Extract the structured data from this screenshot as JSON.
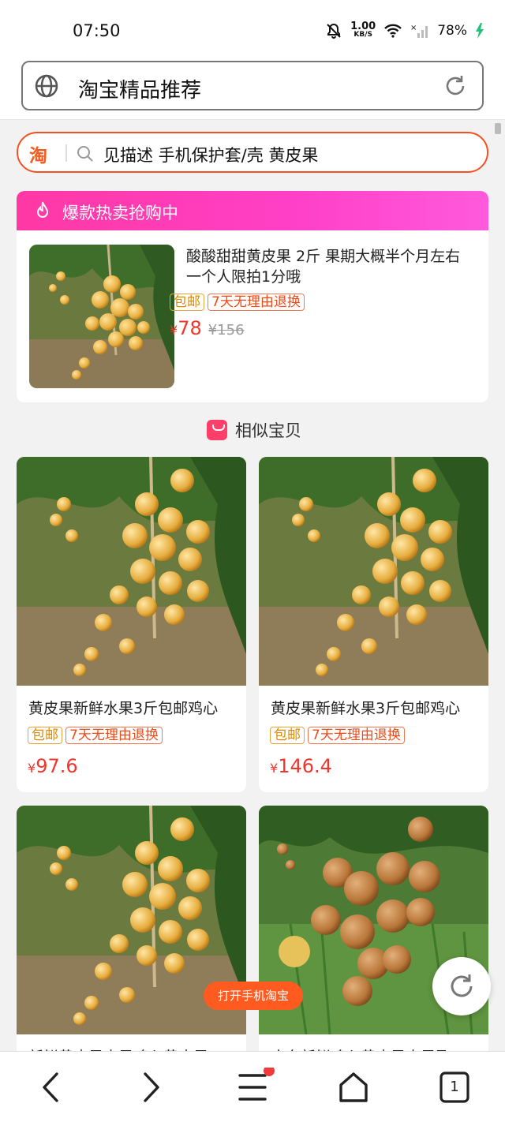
{
  "status_bar": {
    "time": "07:50",
    "net_speed": "1.00",
    "net_unit": "KB/S",
    "battery": "78%"
  },
  "address_bar": {
    "title": "淘宝精品推荐"
  },
  "search": {
    "logo": "淘",
    "query": "见描述 手机保护套/壳 黄皮果"
  },
  "hot_sale": {
    "banner": "爆款热卖抢购中",
    "product": {
      "title": "酸酸甜甜黄皮果 2斤 果期大概半个月左右 一个人限拍1分哦",
      "tags": [
        "包邮",
        "7天无理由退换"
      ],
      "currency": "¥",
      "price": "78",
      "old_price": "¥156"
    }
  },
  "similar": {
    "heading": "相似宝贝"
  },
  "products": [
    {
      "title": "黄皮果新鲜水果3斤包邮鸡心",
      "tags": [
        "包邮",
        "7天无理由退换"
      ],
      "currency": "¥",
      "price": "97.6"
    },
    {
      "title": "黄皮果新鲜水果3斤包邮鸡心",
      "tags": [
        "包邮",
        "7天无理由退换"
      ],
      "currency": "¥",
      "price": "146.4"
    },
    {
      "title": "新鲜黄皮果水果鸡心黄皮果",
      "tags": [],
      "currency": "",
      "price": ""
    },
    {
      "title": "广东新鲜鸡心黄皮果水果孕",
      "tags": [],
      "currency": "",
      "price": ""
    }
  ],
  "open_app_button": "打开手机淘宝",
  "bottom_nav": {
    "tab_count": "1"
  },
  "colors": {
    "accent": "#f5501f",
    "price": "#f0352c",
    "hot_gradient_start": "#ff38a4"
  }
}
